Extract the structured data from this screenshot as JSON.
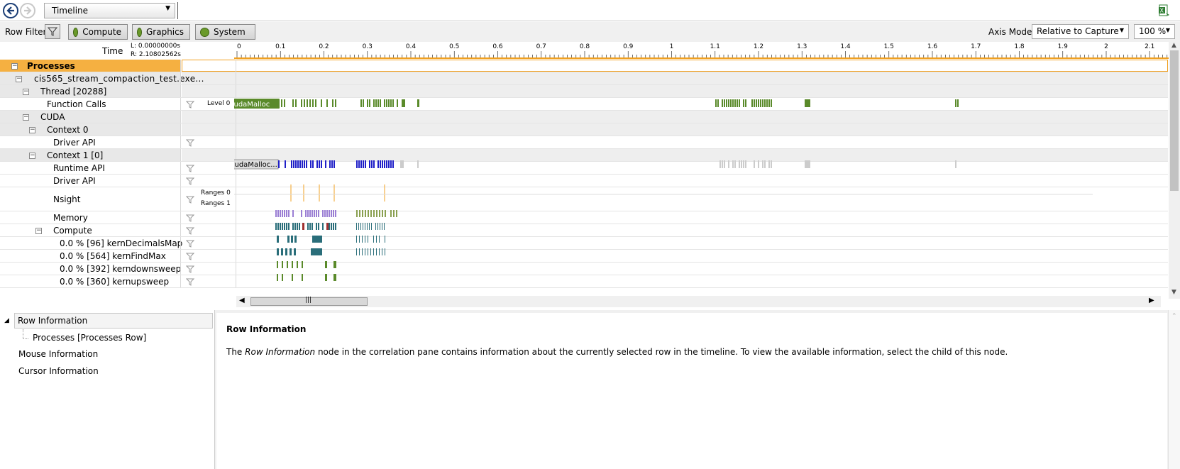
{
  "toolbar": {
    "view": "Timeline",
    "back_icon": "back-arrow-icon",
    "forward_icon": "forward-arrow-icon",
    "export_icon": "excel-export-icon"
  },
  "filters": {
    "label": "Row Filters",
    "buttons": [
      "Compute",
      "Graphics",
      "System"
    ],
    "axis_mode_label": "Axis Mode:",
    "axis_mode": "Relative to Capture",
    "zoom": "100 %"
  },
  "time": {
    "label": "Time",
    "left": "L:  0.00000000s",
    "right": "R:  2.10802562s",
    "ticks": [
      "0",
      "0.1",
      "0.2",
      "0.3",
      "0.4",
      "0.5",
      "0.6",
      "0.7",
      "0.8",
      "0.9",
      "1",
      "1.1",
      "1.2",
      "1.3",
      "1.4",
      "1.5",
      "1.6",
      "1.7",
      "1.8",
      "1.9",
      "2",
      "2.1"
    ]
  },
  "rows": {
    "processes": "Processes",
    "process_name": "cis565_stream_compaction_test.exe...",
    "thread": "Thread [20288]",
    "function_calls": "Function Calls",
    "level0": "Level 0",
    "cuda": "CUDA",
    "context0": "Context 0",
    "driver_api0": "Driver API",
    "context1": "Context 1 [0]",
    "runtime_api": "Runtime API",
    "driver_api1": "Driver API",
    "nsight": "Nsight",
    "ranges0": "Ranges 0",
    "ranges1": "Ranges 1",
    "memory": "Memory",
    "compute": "Compute",
    "k1": "0.0 % [96] kernDecimalsMap",
    "k2": "0.0 % [564] kernFindMax",
    "k3": "0.0 % [392] kerndownsweep",
    "k4": "0.0 % [360] kernupsweep",
    "cuda_malloc_fc": "cudaMalloc",
    "cuda_malloc_rt": "cudaMalloc..."
  },
  "tree": {
    "root": "Row Information",
    "child": "Processes [Processes Row]",
    "mouse": "Mouse Information",
    "cursor": "Cursor Information"
  },
  "info": {
    "title": "Row Information",
    "text_pre": "The ",
    "text_em": "Row Information",
    "text_post": " node in the correlation pane contains information about the currently selected row in the timeline. To view the available information, select the child of this node."
  },
  "colors": {
    "header_orange": "#f5b041",
    "green": "#5a8a2a",
    "blue": "#2020c8",
    "teal": "#2a6e7a",
    "purple": "#9b7fd4",
    "ruler_accent": "#f0a020"
  }
}
